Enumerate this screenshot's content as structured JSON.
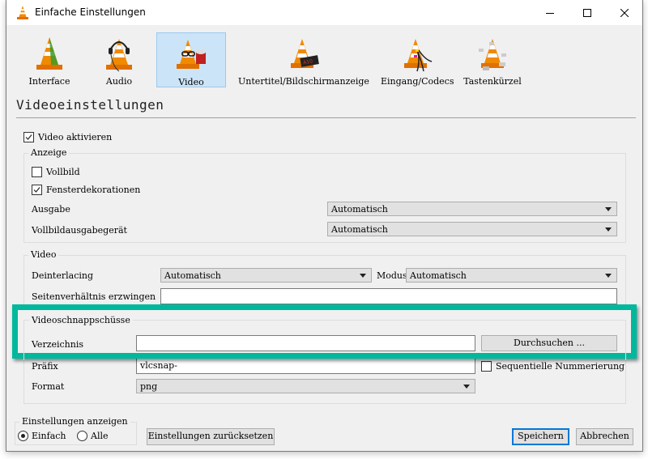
{
  "window": {
    "title": "Einfache Einstellungen",
    "controls": {
      "minimize": "minimize",
      "maximize": "maximize",
      "close": "close"
    }
  },
  "categories": [
    {
      "label": "Interface",
      "icon": "vlc-cone-interface-icon",
      "selected": false
    },
    {
      "label": "Audio",
      "icon": "vlc-cone-headphones-icon",
      "selected": false
    },
    {
      "label": "Video",
      "icon": "vlc-cone-glasses-icon",
      "selected": true
    },
    {
      "label": "Untertitel/Bildschirmanzeige",
      "icon": "vlc-cone-subtitle-icon",
      "selected": false
    },
    {
      "label": "Eingang/Codecs",
      "icon": "vlc-cone-cables-icon",
      "selected": false
    },
    {
      "label": "Tastenkürzel",
      "icon": "vlc-cone-keys-icon",
      "selected": false
    }
  ],
  "page_title": "Videoeinstellungen",
  "video_enable": {
    "label": "Video aktivieren",
    "checked": true
  },
  "display_group": {
    "title": "Anzeige",
    "fullscreen": {
      "label": "Vollbild",
      "checked": false
    },
    "window_decorations": {
      "label": "Fensterdekorationen",
      "checked": true
    },
    "output": {
      "label": "Ausgabe",
      "value": "Automatisch"
    },
    "fullscreen_device": {
      "label": "Vollbildausgabegerät",
      "value": "Automatisch"
    }
  },
  "video_group": {
    "title": "Video",
    "deinterlacing": {
      "label": "Deinterlacing",
      "value": "Automatisch"
    },
    "mode": {
      "label": "Modus",
      "value": "Automatisch"
    },
    "aspect_ratio": {
      "label": "Seitenverhältnis erzwingen",
      "value": ""
    }
  },
  "snapshots_group": {
    "title": "Videoschnappschüsse",
    "directory": {
      "label": "Verzeichnis",
      "value": ""
    },
    "browse_label": "Durchsuchen ...",
    "prefix": {
      "label": "Präfix",
      "value": "vlcsnap-"
    },
    "sequential": {
      "label": "Sequentielle Nummerierung",
      "checked": false
    },
    "format": {
      "label": "Format",
      "value": "png"
    }
  },
  "show_settings": {
    "title": "Einstellungen anzeigen",
    "options": [
      {
        "label": "Einfach",
        "selected": true
      },
      {
        "label": "Alle",
        "selected": false
      }
    ]
  },
  "buttons": {
    "reset": "Einstellungen zurücksetzen",
    "save": "Speichern",
    "cancel": "Abbrechen"
  },
  "highlight_color": "#00b89c",
  "selection_color": "#cce4f7"
}
